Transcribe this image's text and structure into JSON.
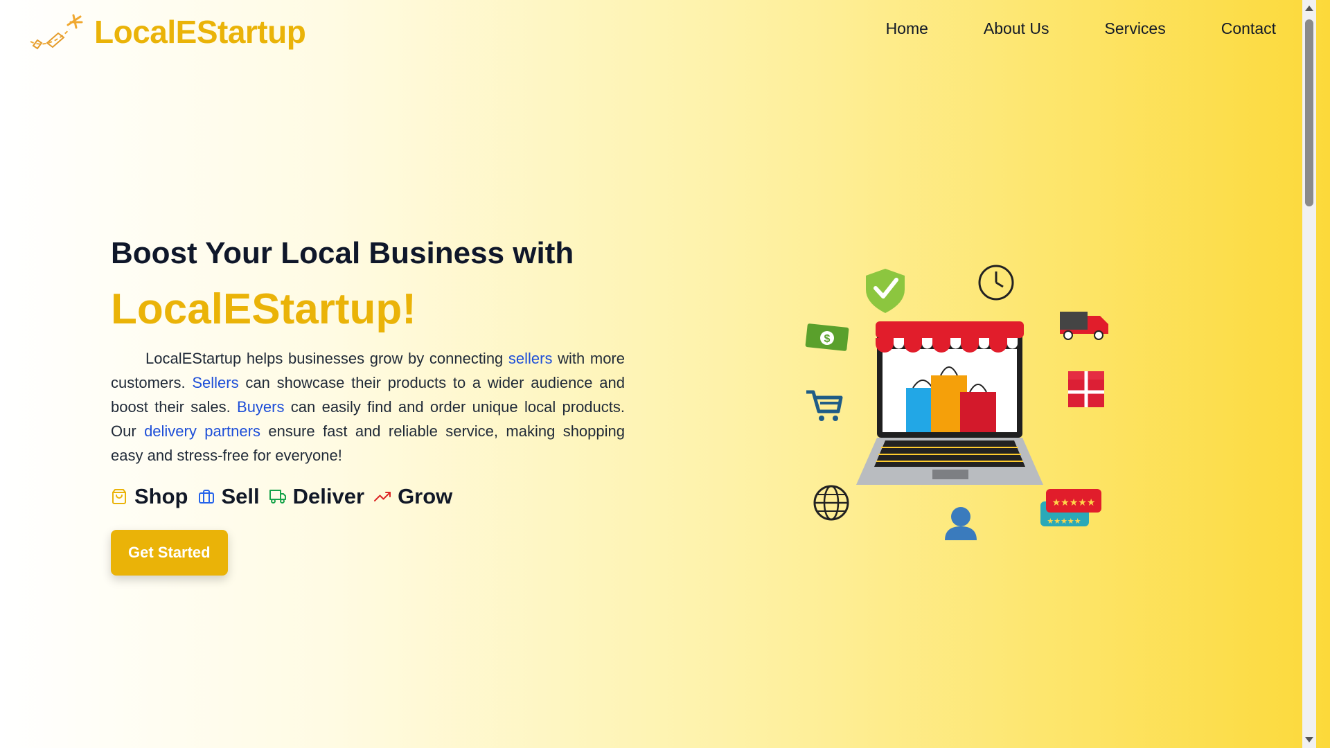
{
  "header": {
    "brand": "LocalEStartup",
    "nav": [
      "Home",
      "About Us",
      "Services",
      "Contact"
    ]
  },
  "hero": {
    "title": "Boost Your Local Business with",
    "brand": "LocalEStartup!",
    "description": {
      "p1": "LocalEStartup helps businesses grow by connecting ",
      "h1": "sellers",
      "p2": " with more customers. ",
      "h2": "Sellers",
      "p3": " can showcase their products to a wider audience and boost their sales. ",
      "h3": "Buyers",
      "p4": " can easily find and order unique local products. Our ",
      "h4": "delivery partners",
      "p5": " ensure fast and reliable service, making shopping easy and stress-free for everyone!"
    },
    "features": [
      {
        "label": "Shop",
        "icon": "shopping-bag-icon",
        "color": "#eab308"
      },
      {
        "label": "Sell",
        "icon": "briefcase-icon",
        "color": "#2563eb"
      },
      {
        "label": "Deliver",
        "icon": "truck-icon",
        "color": "#16a34a"
      },
      {
        "label": "Grow",
        "icon": "trending-up-icon",
        "color": "#dc2626"
      }
    ],
    "cta": "Get Started"
  },
  "colors": {
    "accent": "#eab308",
    "link": "#1d4ed8",
    "text": "#0f172a"
  }
}
